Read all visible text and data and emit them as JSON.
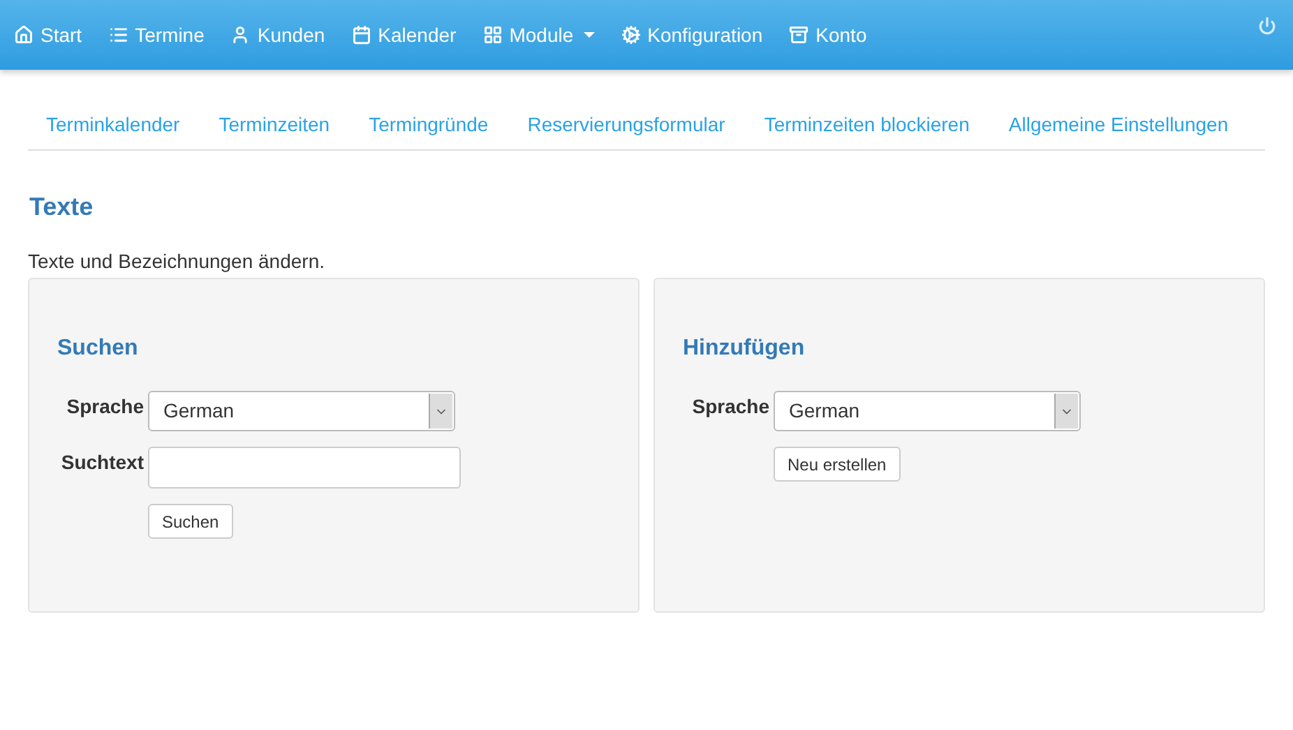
{
  "navbar": {
    "items": [
      {
        "label": "Start",
        "dropdown": false
      },
      {
        "label": "Termine",
        "dropdown": false
      },
      {
        "label": "Kunden",
        "dropdown": false
      },
      {
        "label": "Kalender",
        "dropdown": false
      },
      {
        "label": "Module",
        "dropdown": true
      },
      {
        "label": "Konfiguration",
        "dropdown": false
      },
      {
        "label": "Konto",
        "dropdown": false
      }
    ]
  },
  "subnav": [
    "Terminkalender",
    "Terminzeiten",
    "Termingründe",
    "Reservierungsformular",
    "Terminzeiten blockieren",
    "Allgemeine Einstellungen"
  ],
  "page": {
    "title": "Texte",
    "description": "Texte und Bezeichnungen ändern."
  },
  "panels": [
    {
      "title": "Suchen",
      "fields": [
        {
          "kind": "select",
          "label": "Sprache",
          "value": "German"
        },
        {
          "kind": "text",
          "label": "Suchtext"
        }
      ],
      "button": "Suchen"
    },
    {
      "title": "Hinzufügen",
      "fields": [
        {
          "kind": "select",
          "label": "Sprache",
          "value": "German"
        }
      ],
      "button": "Neu erstellen"
    }
  ]
}
